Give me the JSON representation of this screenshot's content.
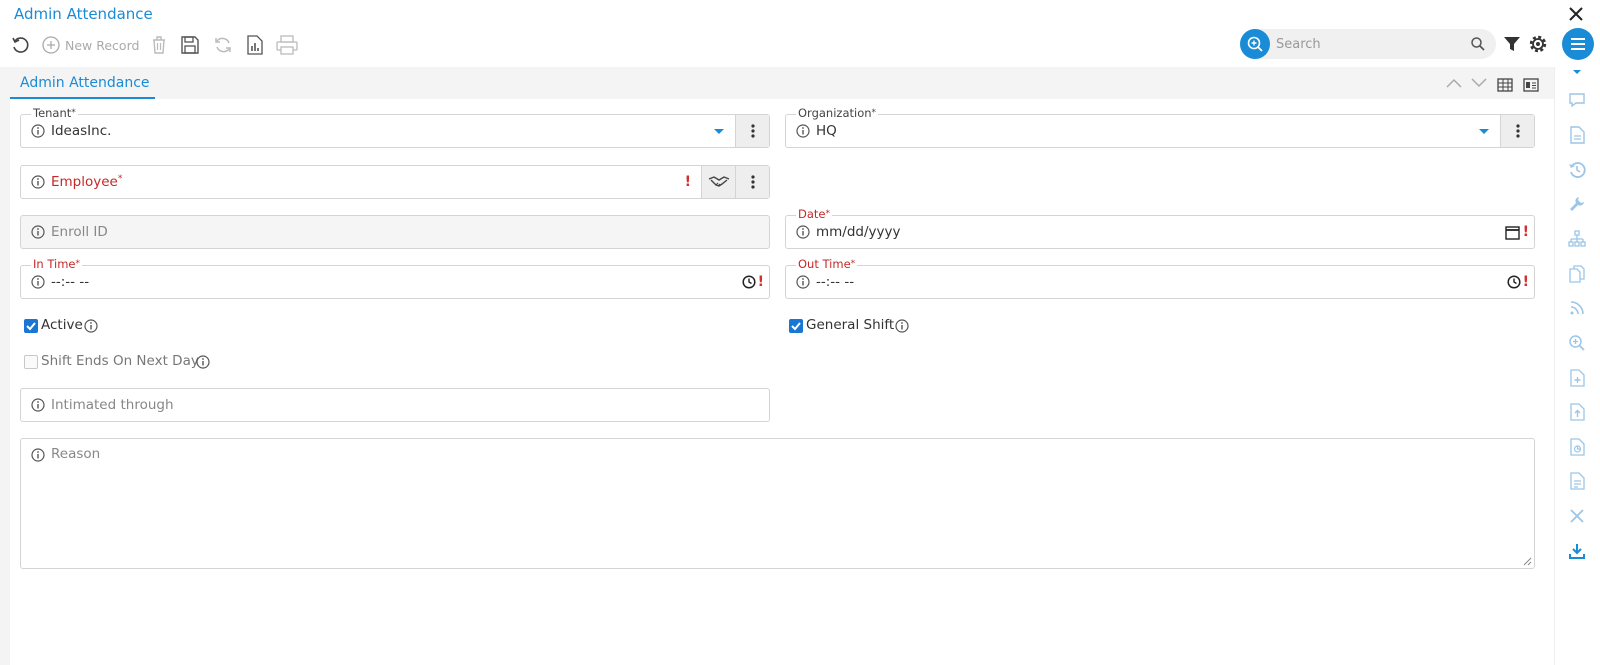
{
  "app": {
    "title": "Admin Attendance"
  },
  "toolbar": {
    "new_record_label": "New Record",
    "search_placeholder": "Search"
  },
  "tab": {
    "label": "Admin Attendance"
  },
  "form": {
    "tenant": {
      "label": "Tenant",
      "required_mark": "*",
      "value": "IdeasInc."
    },
    "organization": {
      "label": "Organization",
      "required_mark": "*",
      "value": "HQ"
    },
    "employee": {
      "label": "Employee",
      "required_mark": "*",
      "error_mark": "!"
    },
    "enroll_id": {
      "placeholder": "Enroll ID"
    },
    "date": {
      "label": "Date",
      "required_mark": "*",
      "value": "mm/dd/yyyy",
      "error_mark": "!"
    },
    "in_time": {
      "label": "In Time",
      "required_mark": "*",
      "value": "--:-- --",
      "error_mark": "!"
    },
    "out_time": {
      "label": "Out Time",
      "required_mark": "*",
      "value": "--:-- --",
      "error_mark": "!"
    },
    "active": {
      "label": "Active",
      "checked": true
    },
    "general_shift": {
      "label": "General Shift",
      "checked": true
    },
    "shift_ends_next_day": {
      "label": "Shift Ends On Next Day",
      "checked": false
    },
    "intimated_through": {
      "placeholder": "Intimated through"
    },
    "reason": {
      "placeholder": "Reason"
    }
  },
  "colors": {
    "accent": "#1a8bd6",
    "error": "#c62828",
    "checkbox": "#1976d2"
  },
  "sidebar_icons": [
    "chevron-down-icon",
    "chat-icon",
    "document-icon",
    "history-icon",
    "wrench-icon",
    "hierarchy-icon",
    "copy-icon",
    "rss-icon",
    "zoom-icon",
    "add-file-icon",
    "upload-file-icon",
    "chart-file-icon",
    "report-file-icon",
    "close-icon",
    "download-icon"
  ]
}
